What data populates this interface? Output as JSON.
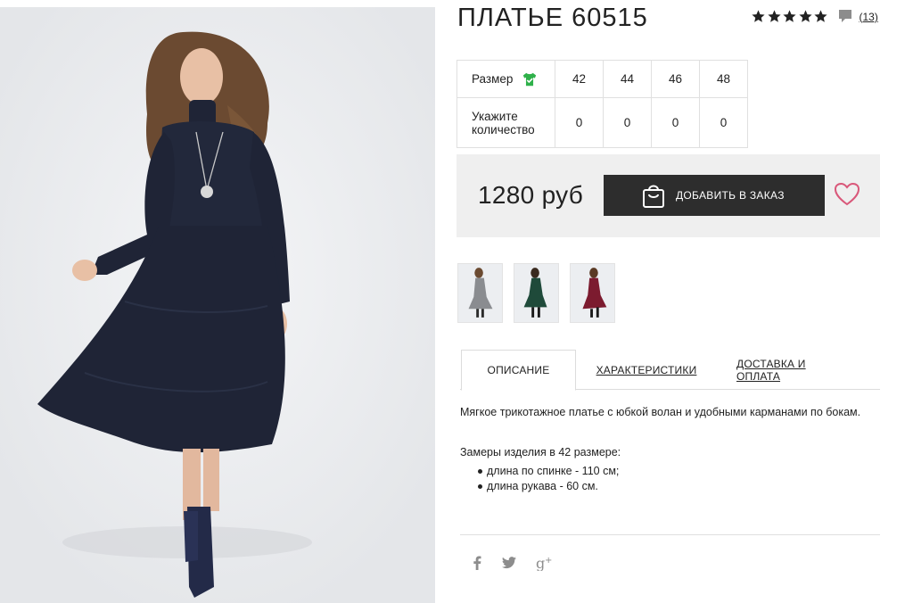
{
  "product": {
    "title": "ПЛАТЬЕ 60515",
    "rating_stars": 5,
    "reviews_count": "(13)"
  },
  "size_table": {
    "size_label": "Размер",
    "qty_label": "Укажите количество",
    "sizes": [
      "42",
      "44",
      "46",
      "48"
    ],
    "quantities": [
      "0",
      "0",
      "0",
      "0"
    ]
  },
  "purchase": {
    "price": "1280 руб",
    "order_button": "ДОБАВИТЬ В ЗАКАЗ"
  },
  "thumbnails": [
    {
      "name": "gray-dress",
      "color": "#8a8c90"
    },
    {
      "name": "green-dress",
      "color": "#1f4a3a"
    },
    {
      "name": "burgundy-dress",
      "color": "#7c1b2f"
    }
  ],
  "tabs": [
    {
      "label": "ОПИСАНИЕ",
      "active": true
    },
    {
      "label": "ХАРАКТЕРИСТИКИ",
      "active": false
    },
    {
      "label": "ДОСТАВКА И ОПЛАТА",
      "active": false
    }
  ],
  "description": {
    "text": "Мягкое трикотажное платье с юбкой волан и удобными карманами по бокам.",
    "measure_heading": "Замеры изделия в 42 размере:",
    "measures": [
      "длина по спинке - 110 см;",
      "длина рукава - 60 см."
    ]
  },
  "social": [
    "facebook-icon",
    "twitter-icon",
    "google-plus-icon"
  ],
  "colors": {
    "button_bg": "#2d2d2d",
    "price_bar_bg": "#efefef",
    "heart": "#d9587a",
    "size_icon": "#2fb14a",
    "dress": "#1f2436"
  }
}
